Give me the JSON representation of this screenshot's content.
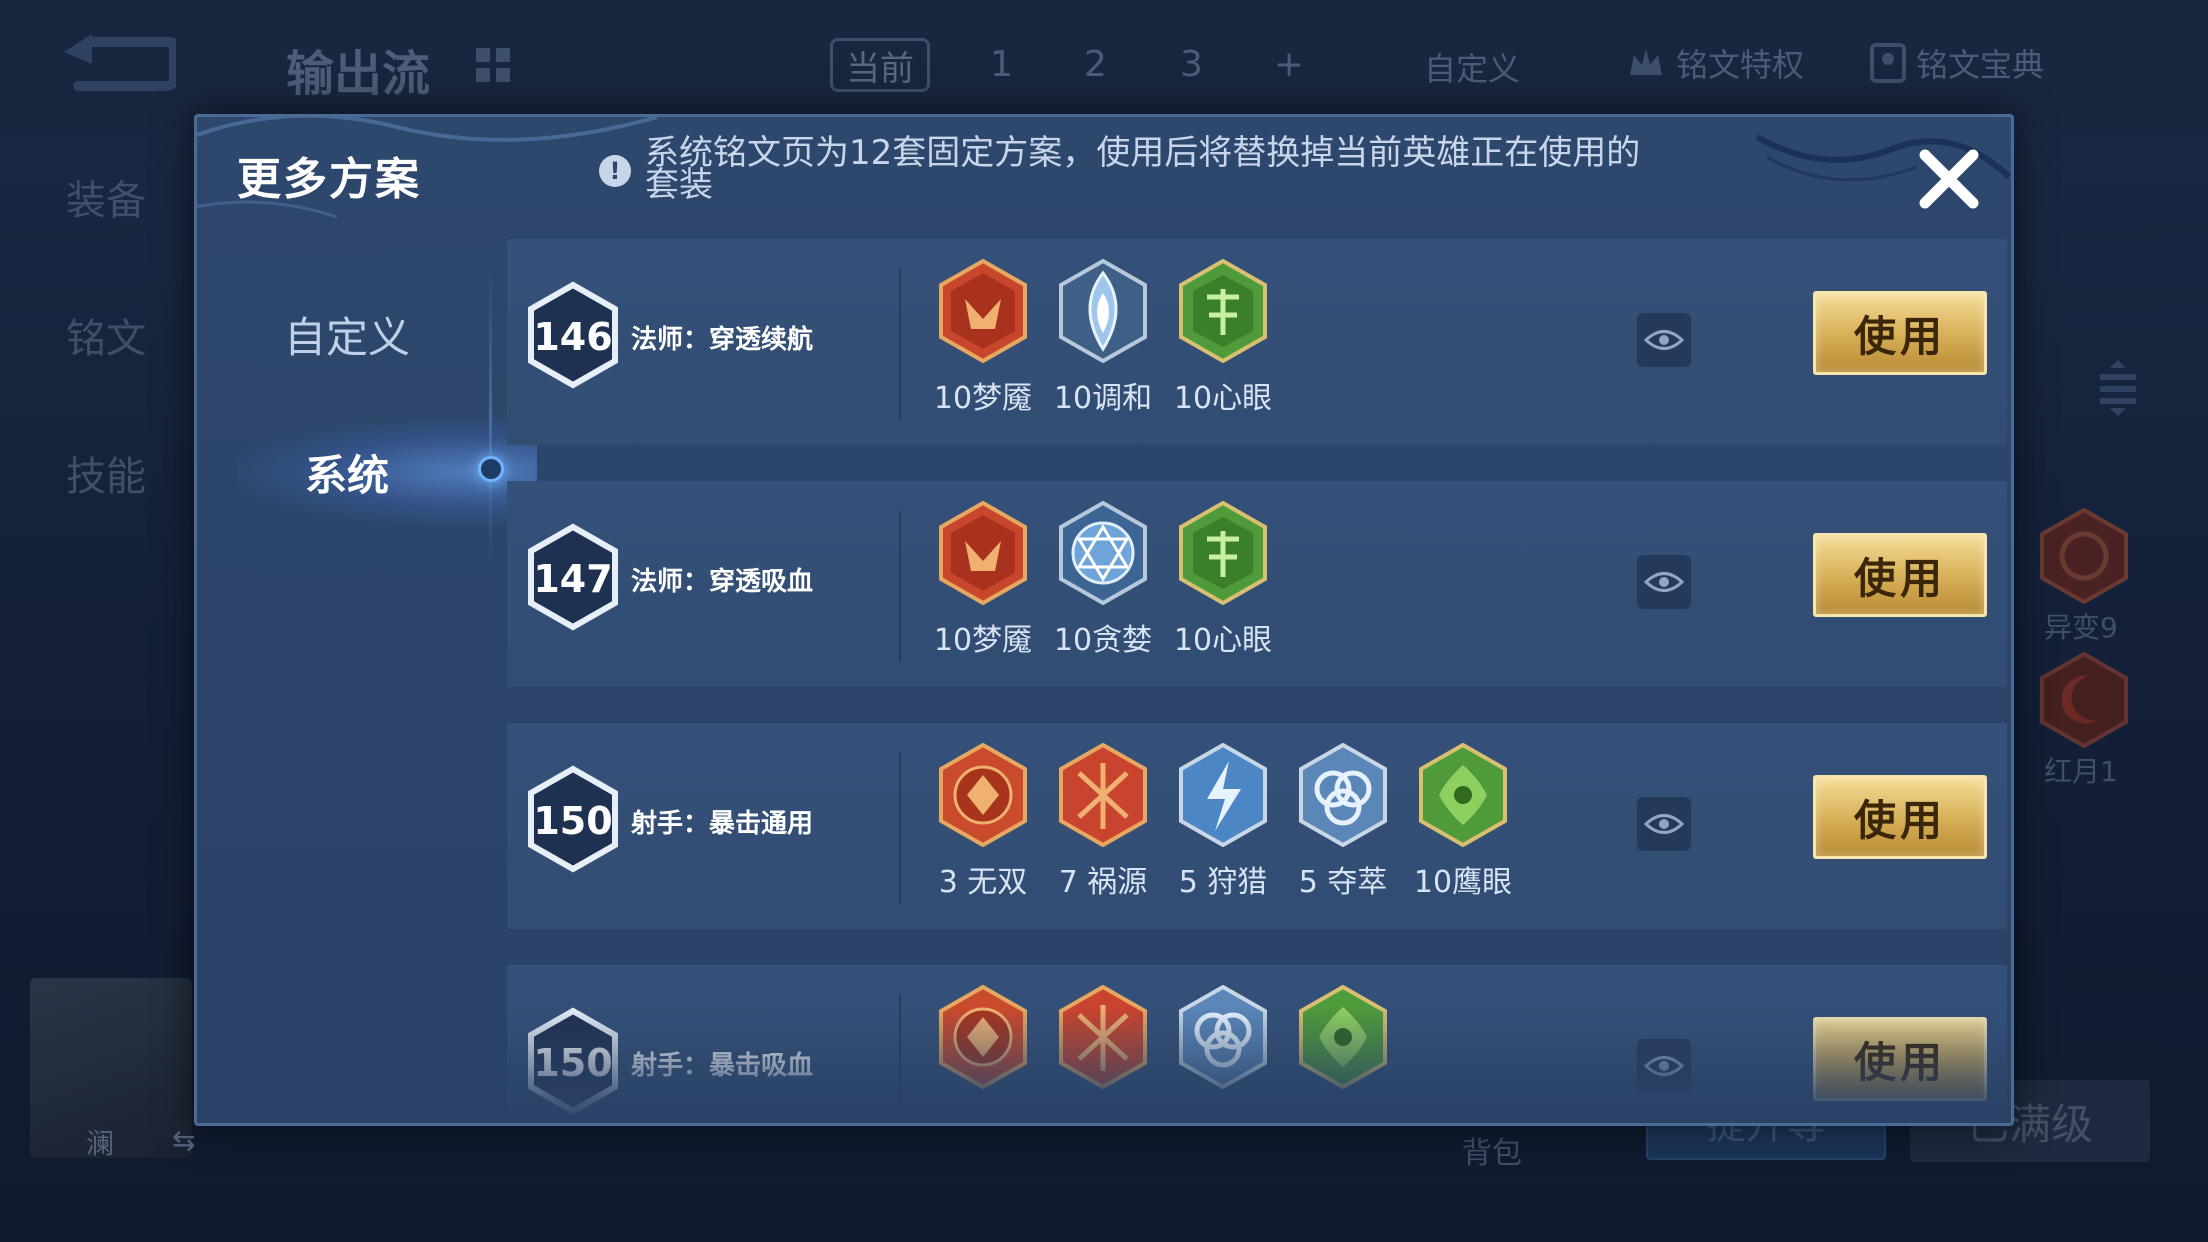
{
  "background": {
    "title": "输出流",
    "tabs": {
      "current": "当前",
      "numbers": [
        "1",
        "2",
        "3",
        "+"
      ],
      "custom": "自定义",
      "privilege": "铭文特权",
      "book": "铭文宝典"
    },
    "side_items": [
      "装备",
      "铭文",
      "技能"
    ],
    "right_runes": [
      {
        "label": "异变9",
        "color": "#7a2a26"
      },
      {
        "label": "红月1",
        "color": "#6b1f1e"
      }
    ],
    "hero_name": "澜",
    "bag_label": "背包",
    "upgrade_label": "提升等",
    "max_level_label": "已满级"
  },
  "modal": {
    "title": "更多方案",
    "notice": "系统铭文页为12套固定方案，使用后将替换掉当前英雄正在使用的套装",
    "nav": {
      "custom": "自定义",
      "system": "系统"
    },
    "use_label": "使用",
    "rows": [
      {
        "level": "146",
        "name": "法师：穿透续航",
        "runes": [
          {
            "label": "10梦魇",
            "icon": "nightmare-rune-icon",
            "color": "#c8472c"
          },
          {
            "label": "10调和",
            "icon": "harmony-rune-icon",
            "color": "#5d8fc0"
          },
          {
            "label": "10心眼",
            "icon": "mind-eye-rune-icon",
            "color": "#4f9a3a"
          }
        ]
      },
      {
        "level": "147",
        "name": "法师：穿透吸血",
        "runes": [
          {
            "label": "10梦魇",
            "icon": "nightmare-rune-icon",
            "color": "#c8472c"
          },
          {
            "label": "10贪婪",
            "icon": "greed-rune-icon",
            "color": "#4d7fb5"
          },
          {
            "label": "10心眼",
            "icon": "mind-eye-rune-icon",
            "color": "#4f9a3a"
          }
        ]
      },
      {
        "level": "150",
        "name": "射手：暴击通用",
        "runes": [
          {
            "label": "3 无双",
            "icon": "peerless-rune-icon",
            "color": "#c94a2c"
          },
          {
            "label": "7 祸源",
            "icon": "calamity-rune-icon",
            "color": "#c9442e"
          },
          {
            "label": "5 狩猎",
            "icon": "hunting-rune-icon",
            "color": "#4d86c4"
          },
          {
            "label": "5 夺萃",
            "icon": "plunder-rune-icon",
            "color": "#5a86b8"
          },
          {
            "label": "10鹰眼",
            "icon": "hawk-eye-rune-icon",
            "color": "#4f9a3a"
          }
        ]
      },
      {
        "level": "150",
        "name": "射手：暴击吸血",
        "runes": [
          {
            "label": "",
            "icon": "peerless-rune-icon",
            "color": "#c94a2c"
          },
          {
            "label": "",
            "icon": "calamity-rune-icon",
            "color": "#c9442e"
          },
          {
            "label": "",
            "icon": "plunder-rune-icon",
            "color": "#5a86b8"
          },
          {
            "label": "",
            "icon": "hawk-eye-rune-icon",
            "color": "#4f9a3a"
          }
        ]
      }
    ]
  },
  "colors": {
    "gold_button": "#d9b25a",
    "panel": "#2e476c",
    "row": "#355179"
  }
}
